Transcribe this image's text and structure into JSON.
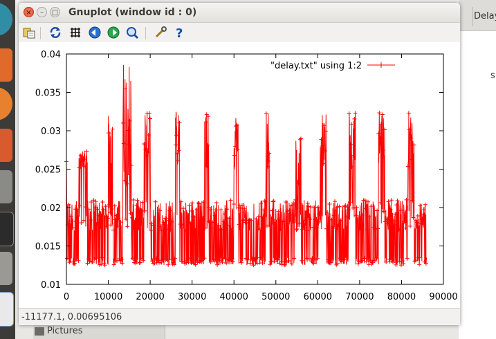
{
  "window": {
    "title": "Gnuplot (window id : 0)",
    "status": "-11177.1,  0.00695106"
  },
  "toolbar": {
    "buttons": [
      "copy-clipboard-icon",
      "replot-icon",
      "grid-icon",
      "previous-zoom-icon",
      "next-zoom-icon",
      "autoscale-icon",
      "preferences-icon",
      "help-icon"
    ]
  },
  "background": {
    "right_tab": "Delay",
    "right_stray": "s",
    "fm_label": "Pictures"
  },
  "colors": {
    "series": "#ff0000",
    "close": "#e0512e"
  },
  "chart_data": {
    "type": "line",
    "xlim": [
      0,
      90000
    ],
    "ylim": [
      0.01,
      0.04
    ],
    "x_ticks": [
      "0",
      "10000",
      "20000",
      "30000",
      "40000",
      "50000",
      "60000",
      "70000",
      "80000",
      "90000"
    ],
    "y_ticks": [
      "0.01",
      "0.015",
      "0.02",
      "0.025",
      "0.03",
      "0.035",
      "0.04"
    ],
    "grid": false,
    "legend": "top-right",
    "series": [
      {
        "name": "\"delay.txt\" using 1:2",
        "color": "#ff0000",
        "markers": "plus",
        "x_range": [
          0,
          86000
        ],
        "low_band": [
          0.0125,
          0.0135
        ],
        "mid_band": [
          0.017,
          0.021
        ],
        "high_bursts": [
          {
            "x": [
              3000,
              5000
            ],
            "y": [
              0.025,
              0.0275
            ]
          },
          {
            "x": [
              10000,
              11000
            ],
            "y": [
              0.025,
              0.0325
            ]
          },
          {
            "x": [
              13500,
              15500
            ],
            "y": [
              0.023,
              0.0398
            ]
          },
          {
            "x": [
              18500,
              20000
            ],
            "y": [
              0.025,
              0.0325
            ]
          },
          {
            "x": [
              26000,
              27000
            ],
            "y": [
              0.025,
              0.0325
            ]
          },
          {
            "x": [
              33000,
              34000
            ],
            "y": [
              0.025,
              0.0325
            ]
          },
          {
            "x": [
              40000,
              41000
            ],
            "y": [
              0.025,
              0.0325
            ]
          },
          {
            "x": [
              47500,
              48500
            ],
            "y": [
              0.025,
              0.0325
            ]
          },
          {
            "x": [
              54500,
              56000
            ],
            "y": [
              0.017,
              0.029
            ]
          },
          {
            "x": [
              60500,
              62000
            ],
            "y": [
              0.025,
              0.0325
            ]
          },
          {
            "x": [
              67500,
              69000
            ],
            "y": [
              0.025,
              0.0325
            ]
          },
          {
            "x": [
              74500,
              76000
            ],
            "y": [
              0.025,
              0.0325
            ]
          },
          {
            "x": [
              81500,
              83000
            ],
            "y": [
              0.025,
              0.0325
            ]
          }
        ]
      }
    ]
  }
}
